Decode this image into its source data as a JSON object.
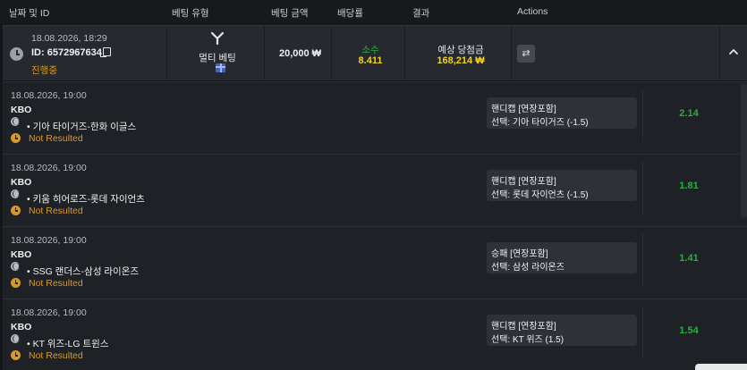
{
  "header": {
    "columns": [
      "날짜 및 ID",
      "베팅 유형",
      "베팅 금액",
      "배당률",
      "결과",
      "Actions"
    ]
  },
  "bet": {
    "date": "18.08.2026, 18:29",
    "id": "ID: 6572967634",
    "status": "진행중",
    "type": "멀티 베팅",
    "amount": "20,000 ₩",
    "odds_label": "소수",
    "odds_value": "8.411",
    "expected_label": "예상 당첨금",
    "expected_value": "168,214 ₩",
    "action_icon": "⇄",
    "icons": [
      "clock-icon",
      "copy-icon",
      "multi-bet-icon",
      "gift-icon",
      "swap-icon",
      "chevron-up-icon"
    ]
  },
  "legs": [
    {
      "date": "18.08.2026, 19:00",
      "league": "KBO",
      "match": "• 기아 타이거즈-한화 이글스",
      "status": "Not Resulted",
      "market": "핸디캡 [연장포함]",
      "selection": "선택: 기아 타이거즈 (-1.5)",
      "odds": "2.14"
    },
    {
      "date": "18.08.2026, 19:00",
      "league": "KBO",
      "match": "• 키움 히어로즈-롯데 자이언츠",
      "status": "Not Resulted",
      "market": "핸디캡 [연장포함]",
      "selection": "선택: 롯데 자이언츠 (-1.5)",
      "odds": "1.81"
    },
    {
      "date": "18.08.2026, 19:00",
      "league": "KBO",
      "match": "• SSG 랜더스-삼성 라이온즈",
      "status": "Not Resulted",
      "market": "승패 [연장포함]",
      "selection": "선택: 삼성 라이온즈",
      "odds": "1.41"
    },
    {
      "date": "18.08.2026, 19:00",
      "league": "KBO",
      "match": "• KT 위즈-LG 트윈스",
      "status": "Not Resulted",
      "market": "핸디캡 [연장포함]",
      "selection": "선택: KT 위즈 (1.5)",
      "odds": "1.54"
    }
  ],
  "colors": {
    "accent_green": "#27b13b",
    "accent_yellow": "#f1d21e",
    "status_orange": "#d59a2f",
    "background": "#14161a",
    "row_background": "#262a30"
  }
}
